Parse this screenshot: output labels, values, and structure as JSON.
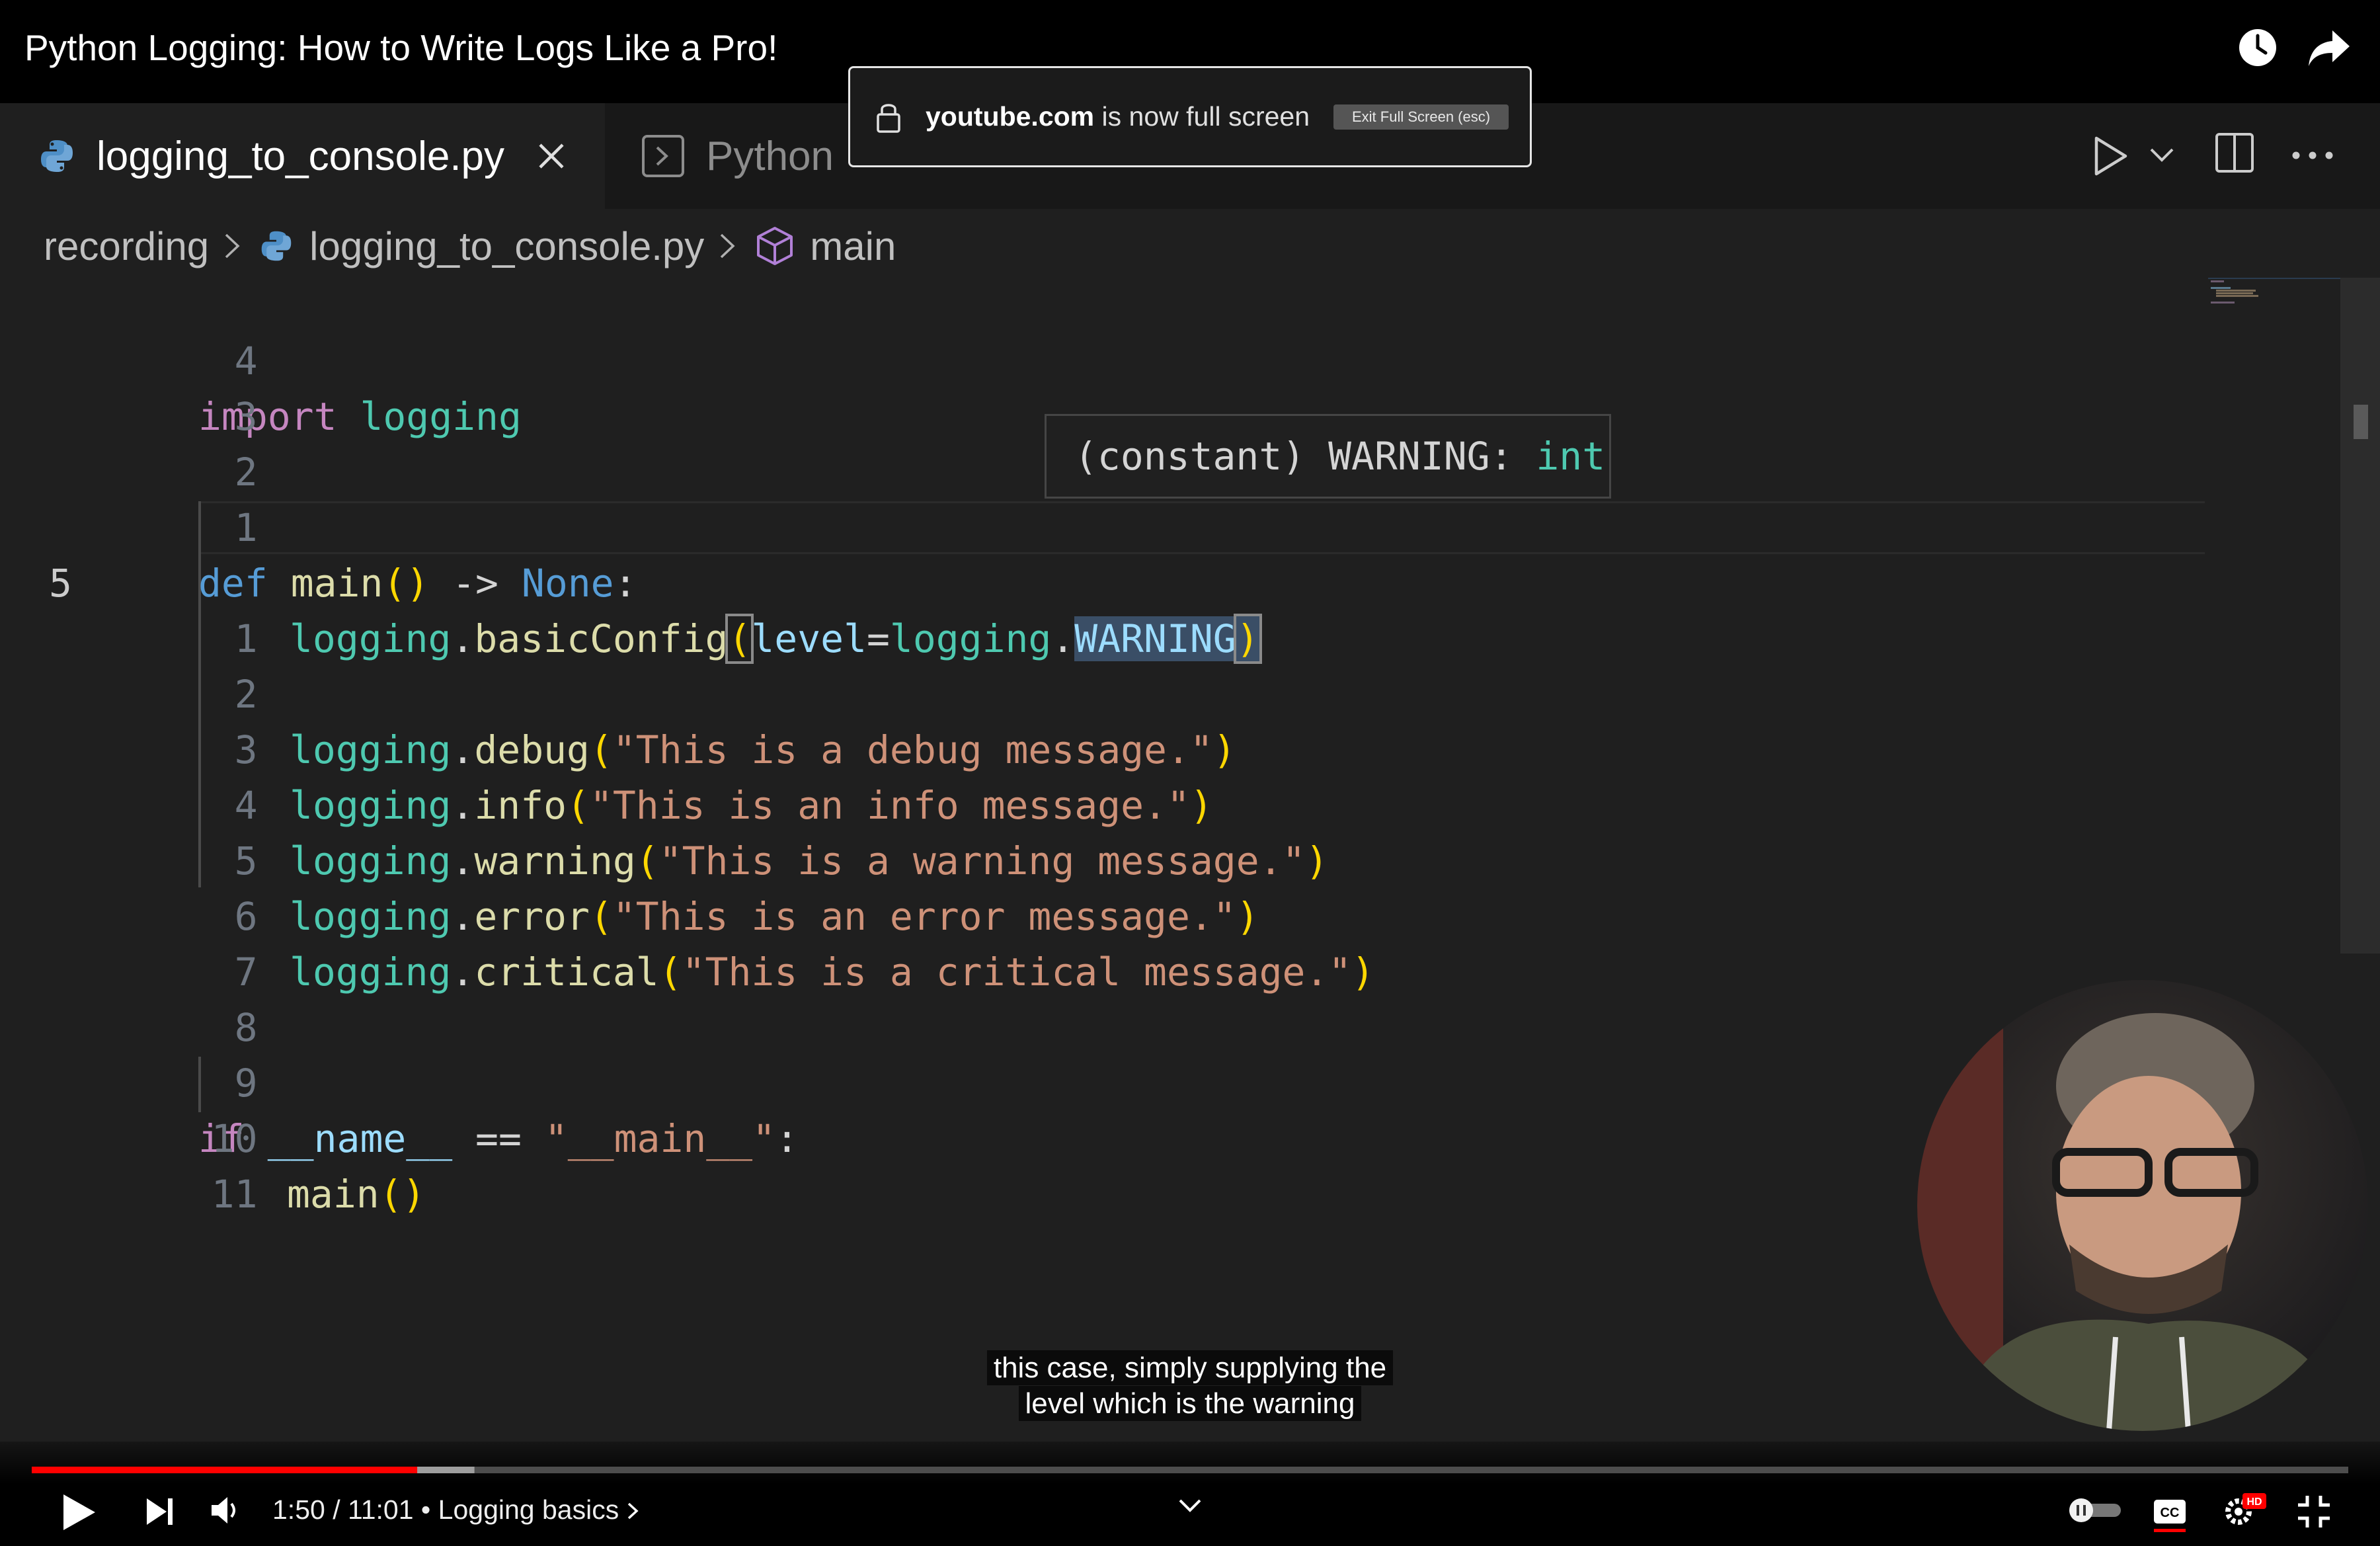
{
  "youtube": {
    "title": "Python Logging: How to Write Logs Like a Pro!",
    "fullscreen_notice": {
      "domain": "youtube.com",
      "message": " is now full screen",
      "exit_label": "Exit Full Screen (esc)"
    },
    "caption_line1": "this case, simply supplying the",
    "caption_line2": "level which is the warning",
    "time": "1:50 / 11:01",
    "chapter_separator": " • ",
    "chapter": "Logging basics",
    "progress_fraction": 0.1664,
    "hd_badge": "HD"
  },
  "editor": {
    "tabs": [
      {
        "label": "logging_to_console.py",
        "active": true
      },
      {
        "label": "Python",
        "active": false
      }
    ],
    "breadcrumb": [
      "recording",
      "logging_to_console.py",
      "main"
    ],
    "hover": {
      "prefix": "(constant) WARNING: ",
      "type": "int"
    },
    "line_numbers": [
      "4",
      "3",
      "2",
      "1",
      "5",
      "1",
      "2",
      "3",
      "4",
      "5",
      "6",
      "7",
      "8",
      "9",
      "10",
      "11"
    ],
    "code": {
      "l1_kw": "import",
      "l1_mod": "logging",
      "l4_def": "def",
      "l4_fn": "main",
      "l4_paren": "()",
      "l4_arrow": " -> ",
      "l4_none": "None",
      "l4_colon": ":",
      "l5_mod": "logging",
      "l5_dot": ".",
      "l5_fn": "basicConfig",
      "l5_open": "(",
      "l5_param": "level",
      "l5_eq": "=",
      "l5_mod2": "logging",
      "l5_dot2": ".",
      "l5_const": "WARNING",
      "l5_close": ")",
      "calls": [
        {
          "fn": "debug",
          "str": "\"This is a debug message.\""
        },
        {
          "fn": "info",
          "str": "\"This is an info message.\""
        },
        {
          "fn": "warning",
          "str": "\"This is a warning message.\""
        },
        {
          "fn": "error",
          "str": "\"This is an error message.\""
        },
        {
          "fn": "critical",
          "str": "\"This is a critical message.\""
        }
      ],
      "l14_kw": "if",
      "l14_var": "__name__",
      "l14_eq": " == ",
      "l14_str": "\"__main__\"",
      "l14_colon": ":",
      "l15_fn": "main",
      "l15_paren": "()"
    }
  },
  "colors": {
    "progress_played": "#ff0000",
    "progress_buffered": "#9e9e9e",
    "progress_rest": "#4d4d4d",
    "python_icon": "#4e8fc7"
  }
}
